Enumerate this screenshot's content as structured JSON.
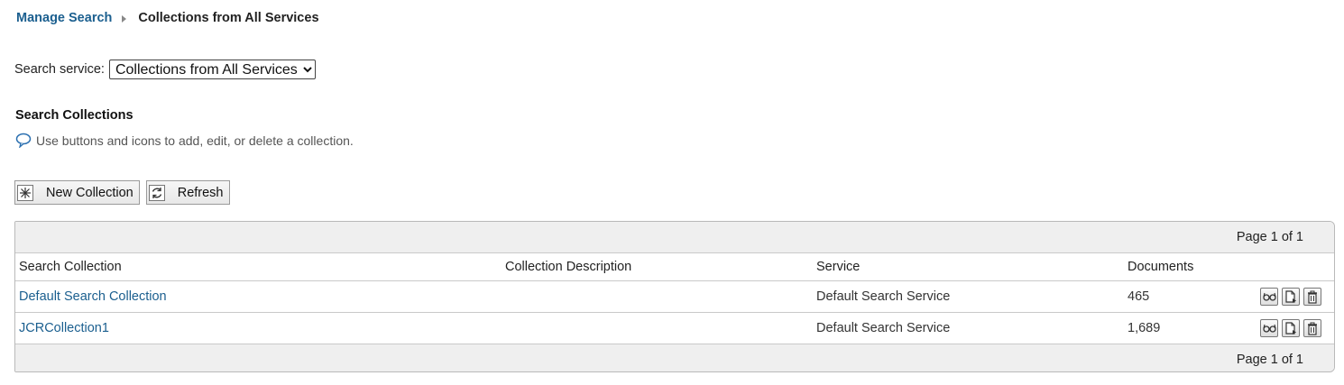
{
  "breadcrumb": {
    "parent": "Manage Search",
    "current": "Collections from All Services"
  },
  "service_selector": {
    "label": "Search service:",
    "selected": "Collections from All Services"
  },
  "section": {
    "title": "Search Collections",
    "help_text": "Use buttons and icons to add, edit, or delete a collection."
  },
  "toolbar": {
    "new_collection_label": "New Collection",
    "refresh_label": "Refresh"
  },
  "table": {
    "pager_text": "Page 1 of 1",
    "columns": [
      "Search Collection",
      "Collection Description",
      "Service",
      "Documents"
    ],
    "rows": [
      {
        "name": "Default Search Collection",
        "description": "",
        "service": "Default Search Service",
        "documents": "465"
      },
      {
        "name": "JCRCollection1",
        "description": "",
        "service": "Default Search Service",
        "documents": "1,689"
      }
    ],
    "row_actions": [
      "view-icon",
      "edit-icon",
      "delete-icon"
    ]
  },
  "colors": {
    "link": "#1b5f8f",
    "header_background": "#efefef",
    "border": "#c9c9c9"
  }
}
